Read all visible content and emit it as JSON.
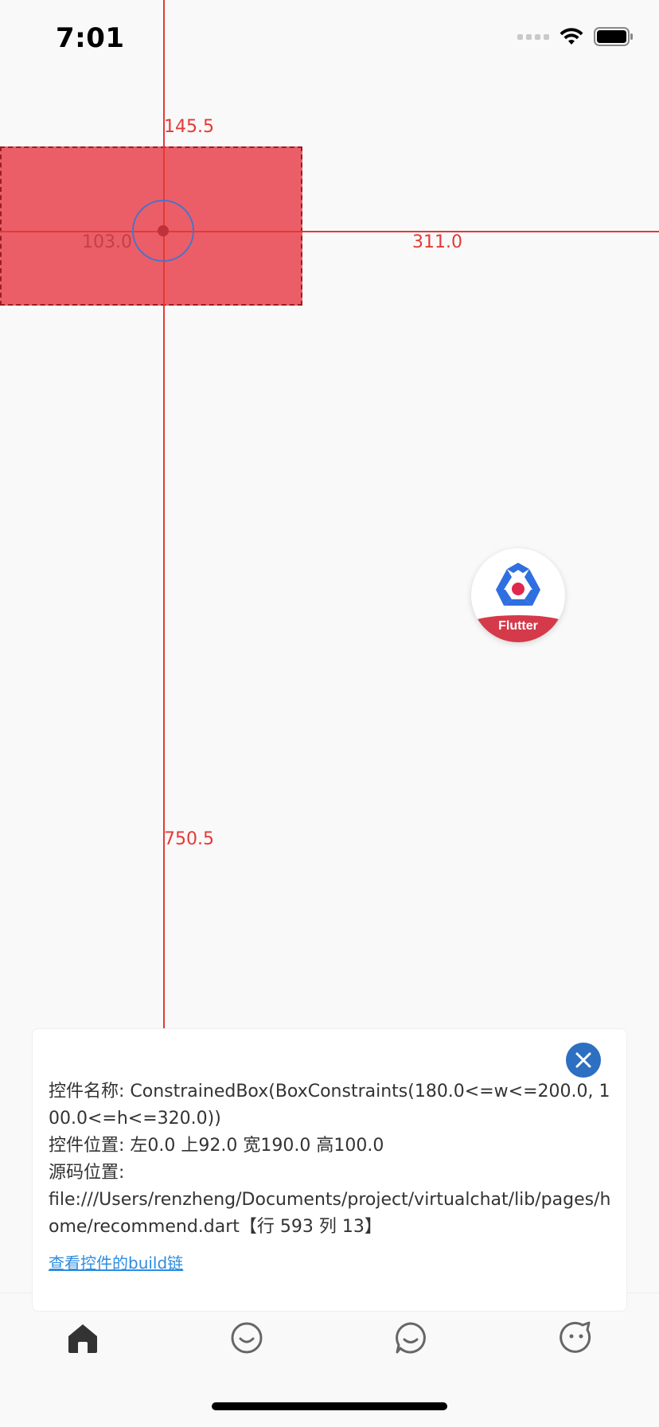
{
  "status_bar": {
    "time": "7:01"
  },
  "inspector": {
    "measure_top": "145.5",
    "measure_left": "103.0",
    "measure_right": "311.0",
    "measure_bottom": "750.5",
    "guide_color": "#e53935",
    "highlight_color": "#e8404c"
  },
  "flutter_badge": {
    "label": "Flutter"
  },
  "info_panel": {
    "name_line": "控件名称: ConstrainedBox(BoxConstraints(180.0<=w<=200.0, 100.0<=h<=320.0))",
    "position_line": "控件位置: 左0.0 上92.0 宽190.0 高100.0",
    "source_label": "源码位置:",
    "source_path": "file:///Users/renzheng/Documents/project/virtualchat/lib/pages/home/recommend.dart【行 593 列 13】",
    "build_link": "查看控件的build链",
    "close_icon": "close-icon",
    "accent_color": "#2d6fc1"
  },
  "tabbar": {
    "tabs": [
      {
        "icon": "home-icon",
        "active": true
      },
      {
        "icon": "smile-icon",
        "active": false
      },
      {
        "icon": "chat-icon",
        "active": false
      },
      {
        "icon": "profile-icon",
        "active": false
      }
    ]
  }
}
